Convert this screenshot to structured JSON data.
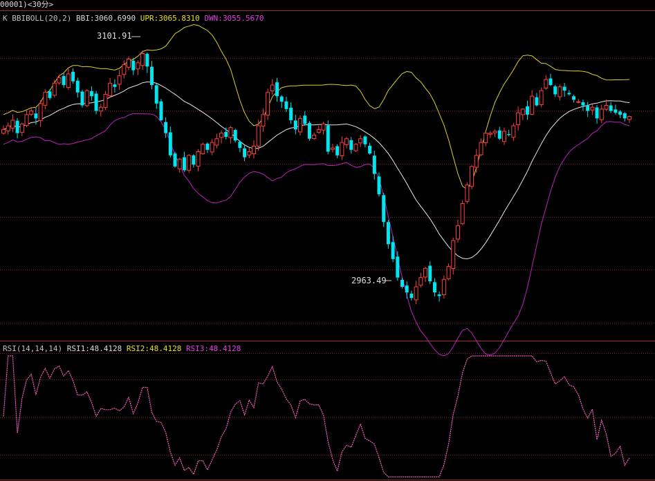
{
  "header": {
    "code": "00001)",
    "period": "<30分>"
  },
  "indicator_top": {
    "prefix": "K",
    "name": "BBIBOLL(20,2)",
    "bbi_label": "BBI:",
    "bbi_value": "3060.6990",
    "upr_label": "UPR:",
    "upr_value": "3065.8310",
    "dwn_label": "DWN:",
    "dwn_value": "3055.5670"
  },
  "indicator_bottom": {
    "name": "RSI(14,14,14)",
    "rsi1_label": "RSI1:",
    "rsi1_value": "48.4128",
    "rsi2_label": "RSI2:",
    "rsi2_value": "48.4128",
    "rsi3_label": "RSI3:",
    "rsi3_value": "48.4128"
  },
  "annotations": {
    "high_label": "3101.91",
    "low_label": "2963.49"
  },
  "colors": {
    "up": "#ff4040",
    "down": "#00e5ee",
    "bbi": "#e8e8e8",
    "upr": "#d8d030",
    "dwn": "#c020c0",
    "rsi": "#ff60c0",
    "grid": "#8b2020",
    "frame": "#a03030"
  },
  "chart_data": {
    "type": "candlestick",
    "price_range": [
      2950,
      3115
    ],
    "rsi_range": [
      20,
      80
    ],
    "close": [
      3060,
      3062,
      3065,
      3058,
      3063,
      3068,
      3070,
      3066,
      3074,
      3080,
      3077,
      3085,
      3088,
      3084,
      3090,
      3086,
      3080,
      3073,
      3081,
      3078,
      3070,
      3072,
      3079,
      3085,
      3083,
      3089,
      3095,
      3098,
      3092,
      3096,
      3101,
      3094,
      3084,
      3074,
      3065,
      3058,
      3046,
      3040,
      3044,
      3038,
      3046,
      3041,
      3048,
      3052,
      3049,
      3053,
      3055,
      3058,
      3056,
      3061,
      3054,
      3050,
      3045,
      3048,
      3051,
      3062,
      3068,
      3080,
      3084,
      3078,
      3075,
      3071,
      3065,
      3060,
      3066,
      3063,
      3055,
      3057,
      3060,
      3063,
      3048,
      3050,
      3046,
      3053,
      3055,
      3049,
      3052,
      3055,
      3052,
      3047,
      3036,
      3025,
      3010,
      2998,
      2990,
      2980,
      2975,
      2972,
      2969,
      2975,
      2980,
      2985,
      2978,
      2972,
      2970,
      2979,
      2986,
      3000,
      3008,
      3020,
      3030,
      3040,
      3046,
      3053,
      3058,
      3058,
      3059,
      3055,
      3059,
      3057,
      3062,
      3069,
      3071,
      3068,
      3078,
      3073,
      3081,
      3087,
      3084,
      3079,
      3083,
      3081,
      3079,
      3076,
      3075,
      3073,
      3070,
      3072,
      3066,
      3071,
      3073,
      3070,
      3069,
      3068,
      3066,
      3067
    ]
  }
}
